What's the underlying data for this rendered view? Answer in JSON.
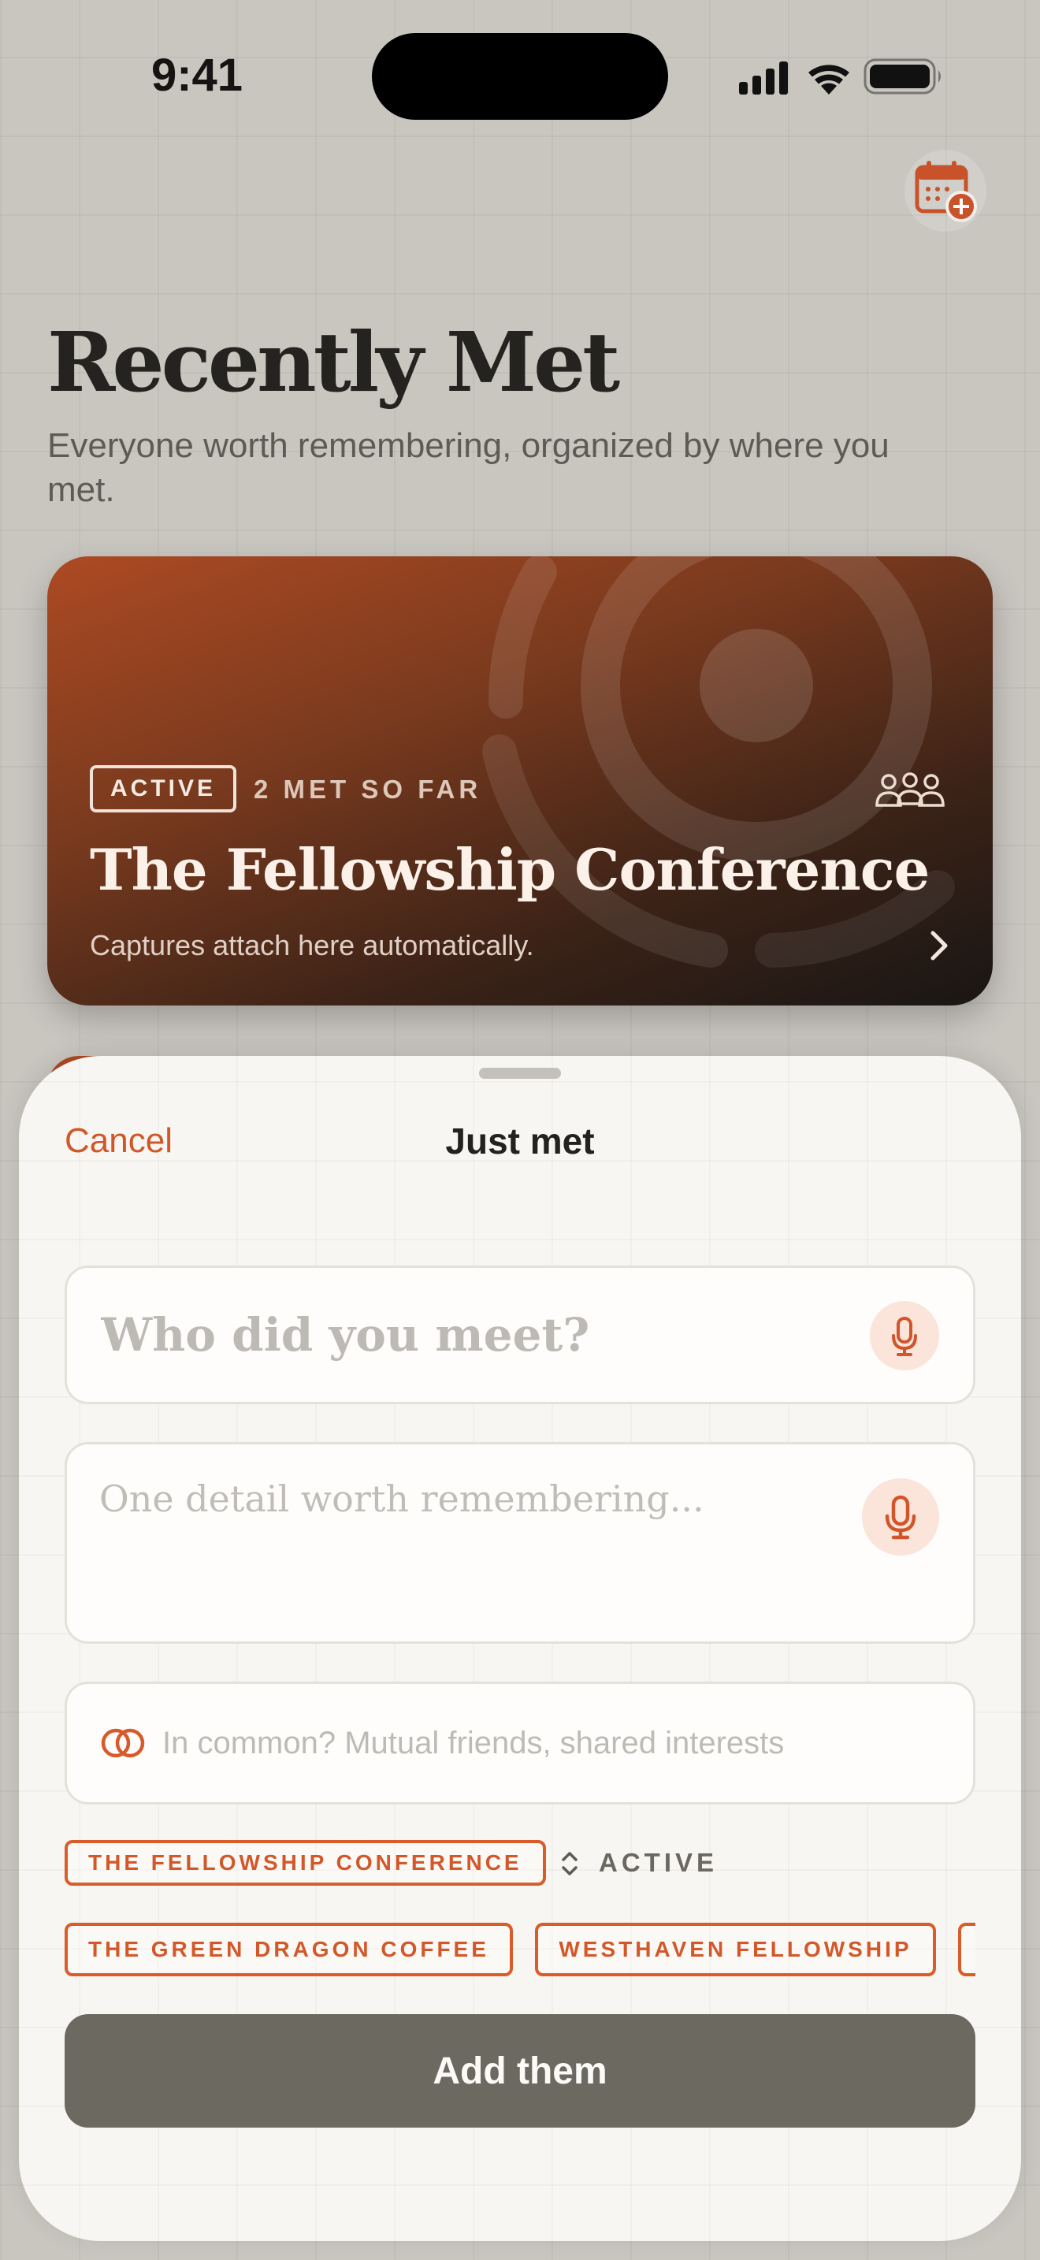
{
  "status_bar": {
    "time": "9:41"
  },
  "header": {
    "title": "Recently Met",
    "subtitle": "Everyone worth remembering, organized by where you met.",
    "add_event_icon": "calendar-plus-icon"
  },
  "event_card": {
    "badge": "ACTIVE",
    "met_count": "2 MET SO FAR",
    "title": "The Fellowship Conference",
    "caption": "Captures attach here automatically.",
    "icons": [
      "people-group-icon",
      "chevron-right-icon"
    ],
    "colors": {
      "gradient_start": "#ad4a23",
      "gradient_end": "#191614"
    }
  },
  "sheet": {
    "cancel_label": "Cancel",
    "title": "Just met",
    "name_placeholder": "Who did you meet?",
    "detail_placeholder": "One detail worth remembering...",
    "common_placeholder": "In common? Mutual friends, shared interests",
    "selected_event": "THE FELLOWSHIP CONFERENCE",
    "selected_status": "ACTIVE",
    "event_chips": [
      {
        "label": "THE GREEN DRAGON COFFEE"
      },
      {
        "label": "WESTHAVEN FELLOWSHIP"
      },
      {
        "label": ""
      }
    ],
    "submit_label": "Add them",
    "colors": {
      "accent": "#d2582a",
      "submit_bg": "#6c6960",
      "mic_bg": "#fbe4d9"
    }
  }
}
